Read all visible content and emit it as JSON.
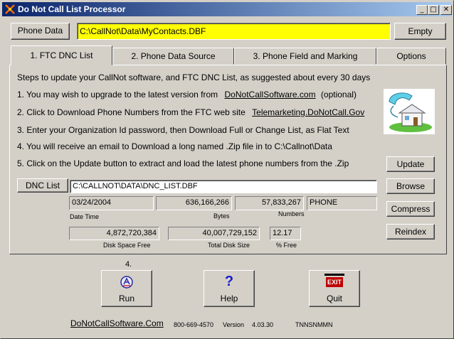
{
  "window": {
    "title": "Do Not Call List Processor",
    "controls": {
      "minimize": "_",
      "maximize": "□",
      "close": "✕"
    }
  },
  "header": {
    "phone_data_label": "Phone Data",
    "phone_data_path": "C:\\CallNot\\Data\\MyContacts.DBF",
    "empty_label": "Empty"
  },
  "tabs": [
    {
      "label": "1. FTC DNC List",
      "active": true
    },
    {
      "label": "2. Phone Data Source",
      "active": false
    },
    {
      "label": "3. Phone Field and Marking",
      "active": false
    },
    {
      "label": "Options",
      "active": false
    }
  ],
  "steps": {
    "intro": "Steps to update your CallNot software, and FTC DNC List, as suggested about every 30 days",
    "s1_text": "1. You may wish to upgrade to the latest version from",
    "s1_link": "DoNotCallSoftware.com",
    "s1_suffix": "(optional)",
    "s2_text": "2. Click to Download Phone Numbers from the FTC web site",
    "s2_link": "Telemarketing.DoNotCall.Gov",
    "s3": "3. Enter your Organization Id password, then Download Full or Change List, as Flat Text",
    "s4": "4. You will receive an email to Download a long named .Zip file in to C:\\Callnot\\Data",
    "s5": "5. Click on the Update button to extract and load the latest phone numbers from the .Zip"
  },
  "dnc": {
    "button_label": "DNC List",
    "path": "C:\\CALLNOT\\DATA\\DNC_LIST.DBF",
    "date_time": "03/24/2004",
    "bytes": "636,166,266",
    "numbers": "57,833,267",
    "field": "PHONE",
    "date_time_caption": "Date Time",
    "bytes_caption": "Bytes",
    "numbers_caption": "Numbers",
    "disk_space_free": "4,872,720,384",
    "total_disk_size": "40,007,729,152",
    "pct_free": "12.17",
    "disk_space_free_caption": "Disk Space Free",
    "total_disk_size_caption": "Total Disk Size",
    "pct_free_caption": "% Free"
  },
  "side_buttons": {
    "update": "Update",
    "browse": "Browse",
    "compress": "Compress",
    "reindex": "Reindex"
  },
  "bottom": {
    "step_marker": "4.",
    "run": "Run",
    "help": "Help",
    "quit": "Quit",
    "exit_sign": "EXIT",
    "help_glyph": "?",
    "website": "DoNotCallSoftware.Com",
    "phone": "800-669-4570",
    "version_label": "Version",
    "version": "4.03.30",
    "code": "TNNSNMMN"
  },
  "colors": {
    "path_highlight": "#ffff00",
    "title_gradient_start": "#0a246a",
    "title_gradient_end": "#a6caf0",
    "face": "#d4d0c8"
  }
}
